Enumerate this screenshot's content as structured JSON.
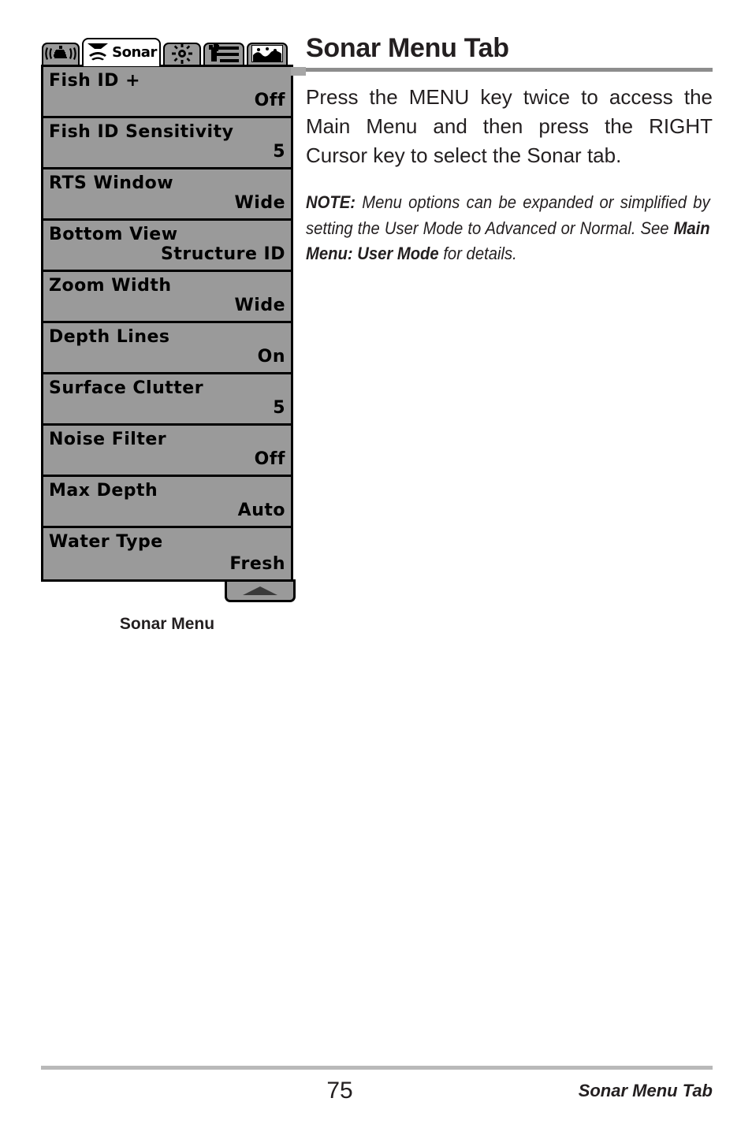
{
  "document": {
    "page_number": "75",
    "footer_right": "Sonar Menu Tab"
  },
  "article": {
    "title": "Sonar Menu Tab",
    "body": "Press the MENU key twice to access the Main Menu and then press the RIGHT Cursor key to select the Sonar tab.",
    "note": {
      "prefix": "NOTE:",
      "text_1": " Menu options can be expanded or simplified by setting the User Mode to Advanced or Normal. See ",
      "emphasis": "Main Menu: User Mode",
      "text_2": " for details."
    }
  },
  "figure": {
    "caption": "Sonar Menu",
    "tabs": [
      {
        "id": "alarms",
        "icon": "alarm-bell-icon",
        "label": "",
        "active": false
      },
      {
        "id": "sonar",
        "icon": "sonar-cone-icon",
        "label": "Sonar",
        "active": true
      },
      {
        "id": "brightness",
        "icon": "sun-brightness-icon",
        "label": "",
        "active": false
      },
      {
        "id": "setup",
        "icon": "wrench-sliders-icon",
        "label": "",
        "active": false
      },
      {
        "id": "views",
        "icon": "chart-view-icon",
        "label": "",
        "active": false
      }
    ],
    "menu_items": [
      {
        "label": "Fish ID +",
        "value": "Off"
      },
      {
        "label": "Fish ID Sensitivity",
        "value": "5"
      },
      {
        "label": "RTS Window",
        "value": "Wide"
      },
      {
        "label": "Bottom View",
        "value": "Structure ID"
      },
      {
        "label": "Zoom Width",
        "value": "Wide"
      },
      {
        "label": "Depth Lines",
        "value": "On"
      },
      {
        "label": "Surface Clutter",
        "value": "5"
      },
      {
        "label": "Noise Filter",
        "value": "Off"
      },
      {
        "label": "Max Depth",
        "value": "Auto"
      },
      {
        "label": "Water Type",
        "value": "Fresh"
      }
    ],
    "scroll_indicator": "scroll-up-arrow"
  },
  "colors": {
    "menu_background": "#9a9a9a",
    "menu_border": "#000000",
    "title_rule": "#8d8d8d",
    "footer_rule": "#b9b9b9",
    "text": "#231f20"
  }
}
